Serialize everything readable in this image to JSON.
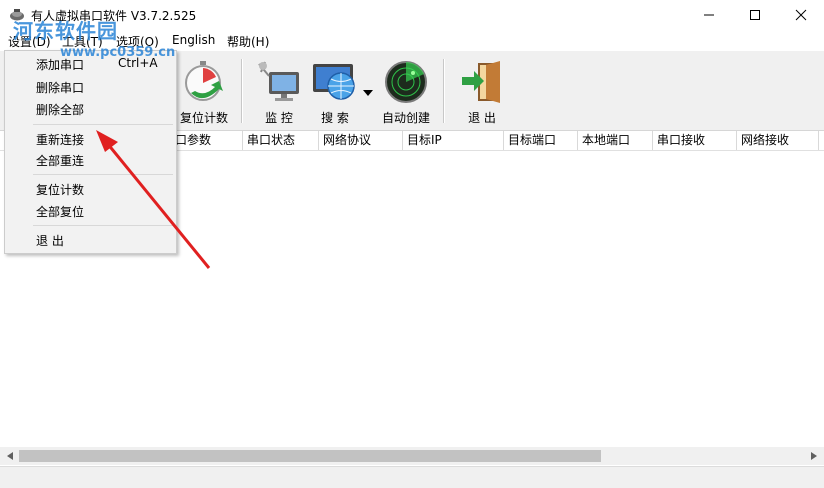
{
  "window": {
    "title": "有人虚拟串口软件 V3.7.2.525"
  },
  "watermark": {
    "text": "河东软件园",
    "url": "www.pc0359.cn"
  },
  "menu": {
    "items": [
      {
        "label": "设置(D)"
      },
      {
        "label": "工具(T)"
      },
      {
        "label": "选项(O)"
      },
      {
        "label": "English"
      },
      {
        "label": "帮助(H)"
      }
    ]
  },
  "toolbar": {
    "reset_count": "复位计数",
    "monitor": "监 控",
    "search": "搜 索",
    "auto_create": "自动创建",
    "exit": "退 出"
  },
  "table": {
    "columns": [
      "口参数",
      "串口状态",
      "网络协议",
      "目标IP",
      "目标端口",
      "本地端口",
      "串口接收",
      "网络接收"
    ]
  },
  "dropdown": {
    "items": [
      {
        "label": "添加串口",
        "shortcut": "Ctrl+A"
      },
      {
        "label": "删除串口"
      },
      {
        "label": "删除全部"
      },
      {
        "label": "重新连接"
      },
      {
        "label": "全部重连"
      },
      {
        "label": "复位计数"
      },
      {
        "label": "全部复位"
      },
      {
        "label": "退 出"
      }
    ]
  },
  "colors": {
    "annotation_arrow": "#e02020",
    "watermark": "#2a84d6"
  }
}
